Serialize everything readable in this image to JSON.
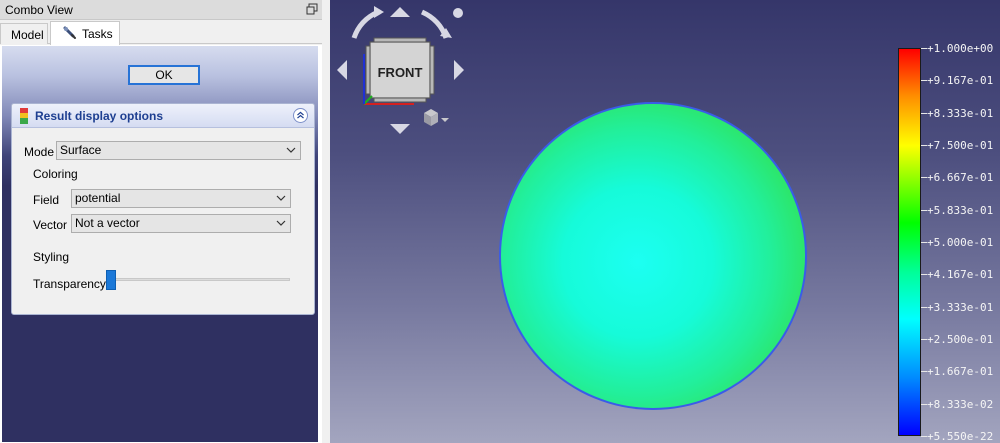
{
  "dock": {
    "title": "Combo View",
    "tabs": [
      {
        "label": "Model"
      },
      {
        "label": "Tasks"
      }
    ]
  },
  "task": {
    "ok_label": "OK",
    "result_panel": {
      "title": "Result display options",
      "mode_label": "Mode",
      "mode_value": "Surface",
      "coloring_label": "Coloring",
      "field_label": "Field",
      "field_value": "potential",
      "vector_label": "Vector",
      "vector_value": "Not a vector",
      "styling_label": "Styling",
      "transparency_label": "Transparency",
      "transparency_value": 0
    }
  },
  "view": {
    "navcube_face": "FRONT",
    "colorbar": {
      "labels": [
        "+1.000e+00",
        "+9.167e-01",
        "+8.333e-01",
        "+7.500e-01",
        "+6.667e-01",
        "+5.833e-01",
        "+5.000e-01",
        "+4.167e-01",
        "+3.333e-01",
        "+2.500e-01",
        "+1.667e-01",
        "+8.333e-02",
        "+5.550e-22"
      ]
    }
  },
  "colors": {
    "accent": "#2773d6",
    "panel_title": "#1e3f91",
    "slider": "#1b78d8"
  }
}
